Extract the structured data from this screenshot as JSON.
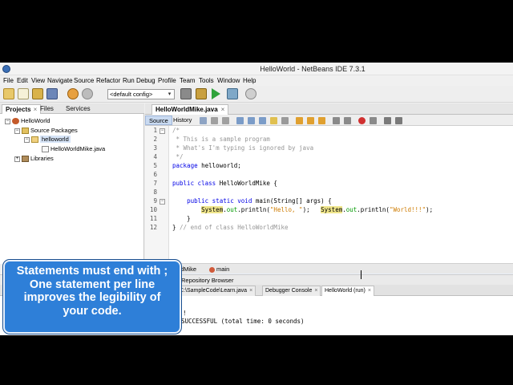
{
  "window": {
    "title": "HelloWorld - NetBeans IDE 7.3.1"
  },
  "menu": [
    "File",
    "Edit",
    "View",
    "Navigate",
    "Source",
    "Refactor",
    "Run",
    "Debug",
    "Profile",
    "Team",
    "Tools",
    "Window",
    "Help"
  ],
  "toolbar": {
    "config_value": "<default config>"
  },
  "project_panel": {
    "tabs": [
      "Projects",
      "Files",
      "Services"
    ],
    "tree": [
      {
        "label": "HelloWorld",
        "level": 0
      },
      {
        "label": "Source Packages",
        "level": 1
      },
      {
        "label": "helloworld",
        "level": 2
      },
      {
        "label": "HelloWorldMike.java",
        "level": 3
      },
      {
        "label": "Libraries",
        "level": 1
      }
    ]
  },
  "editor": {
    "file_tab": "HelloWorldMike.java",
    "source_tab": "Source",
    "history_tab": "History",
    "lines": [
      {
        "n": "1",
        "text": "/*"
      },
      {
        "n": "2",
        "text": " * This is a sample program"
      },
      {
        "n": "3",
        "text": " * What's I'm typing is ignored by java"
      },
      {
        "n": "4",
        "text": " */"
      },
      {
        "n": "5",
        "text": "package helloworld;"
      },
      {
        "n": "6",
        "text": ""
      },
      {
        "n": "7",
        "text": "public class HelloWorldMike {"
      },
      {
        "n": "8",
        "text": ""
      },
      {
        "n": "9",
        "text": "    public static void main(String[] args) {"
      },
      {
        "n": "10",
        "text": "        System.out.println(\"Hello, \");   System.out.println(\"World!!!\");"
      },
      {
        "n": "11",
        "text": "    }"
      },
      {
        "n": "12",
        "text": "} // end of class HelloWorldMike"
      }
    ]
  },
  "navigator": {
    "left": "dMike",
    "method": "main"
  },
  "repository_bar": {
    "label": "Repository Browser"
  },
  "output_tabs": [
    {
      "label": "C:\\SampleCode\\Learn.java"
    },
    {
      "label": "Debugger Console"
    },
    {
      "label": "HelloWorld (run)"
    }
  ],
  "output": {
    "line1": "!",
    "line2": "SUCCESSFUL (total time: 0 seconds)"
  },
  "callout": {
    "line1": "Statements must end with ;",
    "line2": "One statement per line",
    "line3": "improves the legibility of",
    "line4": "your code."
  },
  "colors": {
    "callout_bg": "#2e7fd8",
    "keyword": "#0000e6",
    "string": "#ce7b00",
    "comment": "#969696"
  }
}
